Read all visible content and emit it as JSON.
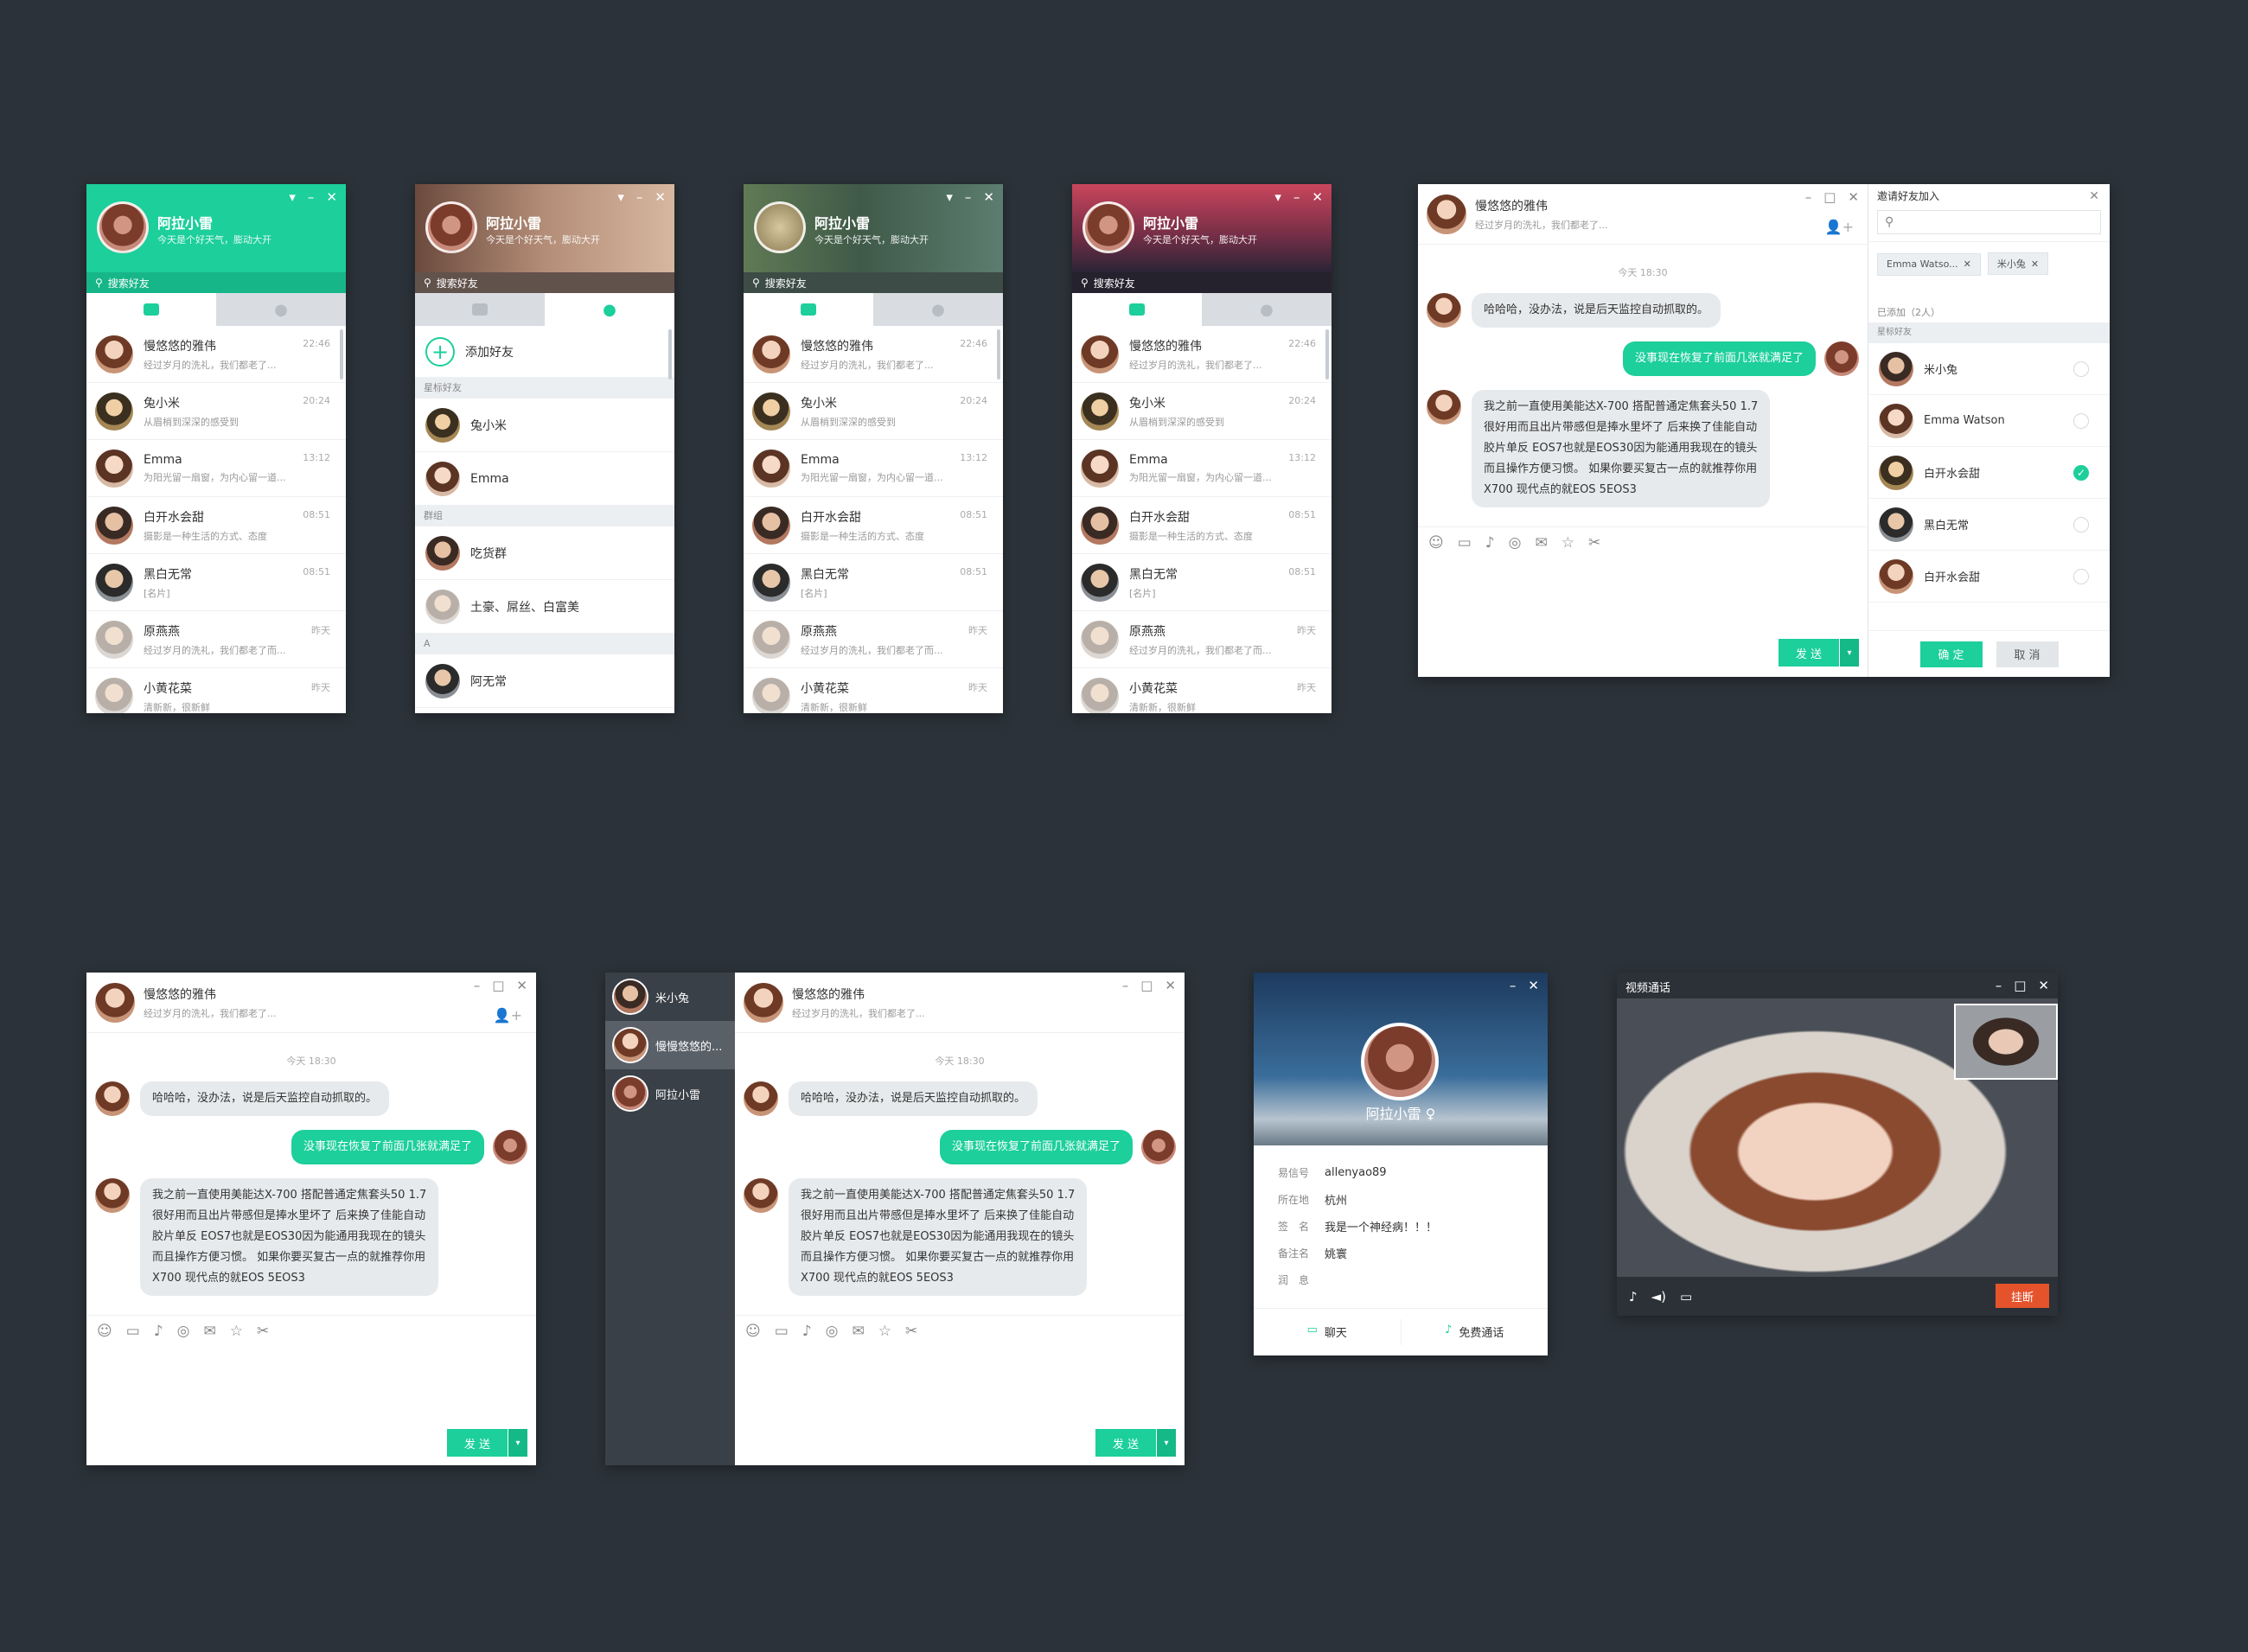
{
  "me": {
    "name": "阿拉小雷",
    "signature": "今天是个好天气，膨动大开"
  },
  "search_placeholder": "搜索好友",
  "conversations": [
    {
      "name": "慢悠悠的雅伟",
      "msg": "经过岁月的洗礼，我们都老了...",
      "time": "22:46"
    },
    {
      "name": "兔小米",
      "msg": "从眉梢到深深的感受到",
      "time": "20:24"
    },
    {
      "name": "Emma",
      "msg": "为阳光留一扇窗，为内心留一道...",
      "time": "13:12"
    },
    {
      "name": "白开水会甜",
      "msg": "摄影是一种生活的方式、态度",
      "time": "08:51"
    },
    {
      "name": "黑白无常",
      "msg": "[名片]",
      "time": "08:51"
    },
    {
      "name": "原燕燕",
      "msg": "经过岁月的洗礼，我们都老了而...",
      "time": "昨天"
    },
    {
      "name": "小黄花菜",
      "msg": "清新新，很新鲜",
      "time": "昨天"
    }
  ],
  "contacts": {
    "add_friend": "添加好友",
    "starred_label": "星标好友",
    "starred": [
      "兔小米",
      "Emma"
    ],
    "groups_label": "群组",
    "groups": [
      "吃货群",
      "土豪、屌丝、白富美"
    ],
    "letter": "A",
    "letter_items": [
      "阿无常"
    ]
  },
  "chat": {
    "name": "慢悠悠的雅伟",
    "status": "经过岁月的洗礼，我们都老了...",
    "time_stamp": "今天 18:30",
    "msg1": "哈哈哈，没办法，说是后天监控自动抓取的。",
    "msg2": "没事现在恢复了前面几张就满足了",
    "msg3_lines": [
      "我之前一直使用美能达X-700 搭配普通定焦套头50 1.7",
      "很好用而且出片带感但是捧水里坏了 后来换了佳能自动",
      "胶片单反 EOS7也就是EOS30因为能通用我现在的镜头",
      "而且操作方便习惯。 如果你要买复古一点的就推荐你用",
      "X700 现代点的就EOS 5EOS3"
    ],
    "send": "发 送"
  },
  "invite": {
    "title": "邀请好友加入",
    "tags": [
      "Emma Watso...",
      "米小兔"
    ],
    "added": "已添加（2人）",
    "starred_label": "星标好友",
    "people": [
      {
        "name": "米小兔",
        "checked": false
      },
      {
        "name": "Emma Watson",
        "checked": false
      },
      {
        "name": "白开水会甜",
        "checked": true
      },
      {
        "name": "黑白无常",
        "checked": false
      },
      {
        "name": "白开水会甜",
        "checked": false
      }
    ],
    "ok": "确 定",
    "cancel": "取 消"
  },
  "sessions": [
    {
      "name": "米小兔"
    },
    {
      "name": "慢慢悠悠的..."
    },
    {
      "name": "阿拉小雷"
    }
  ],
  "profile": {
    "name": "阿拉小雷 ♀",
    "rows": [
      {
        "k": "易信号",
        "v": "allenyao89"
      },
      {
        "k": "所在地",
        "v": "杭州"
      },
      {
        "k": "签　名",
        "v": "我是一个神经病！！！"
      },
      {
        "k": "备注名",
        "v": "姚寰"
      },
      {
        "k": "润　息",
        "v": ""
      }
    ],
    "chat": "聊天",
    "call": "免费通话"
  },
  "video": {
    "title": "视频通话",
    "hangup": "挂断"
  },
  "colors": {
    "accent": "#1ccf9b",
    "bg": "#2b3239",
    "hangup": "#e5532d"
  }
}
